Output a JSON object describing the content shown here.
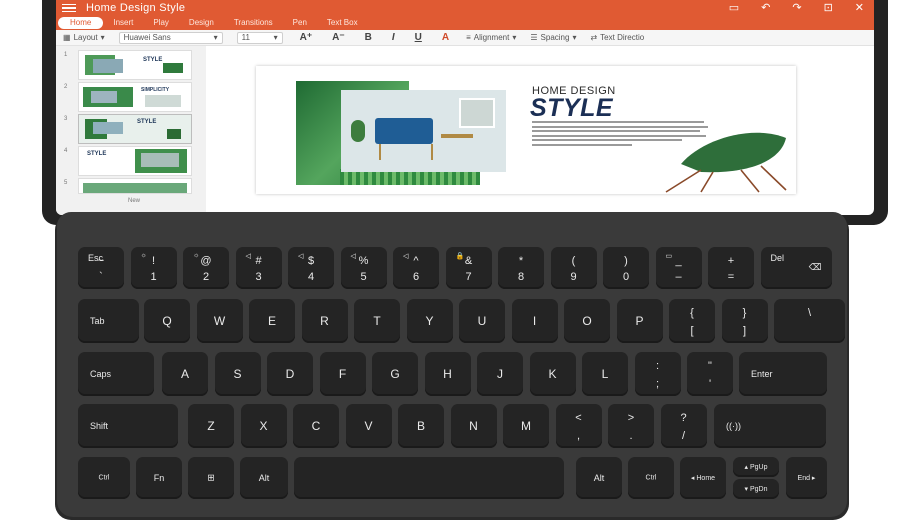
{
  "app": {
    "title": "Home Design Style",
    "title_icons": [
      "slideshow-icon",
      "undo-icon",
      "redo-icon",
      "share-icon",
      "close-icon"
    ],
    "accent": "#e05a33"
  },
  "tabs": [
    "Home",
    "Insert",
    "Play",
    "Design",
    "Transitions",
    "Pen",
    "Text Box"
  ],
  "toolbar": {
    "layout": "Layout",
    "font": "Huawei Sans",
    "size": "11",
    "alignment": "Alignment",
    "spacing": "Spacing",
    "text_direction": "Text Directio"
  },
  "thumbnails": {
    "numbers": [
      "1",
      "2",
      "3",
      "4",
      "5"
    ],
    "titles": [
      "STYLE",
      "SIMPLICITY",
      "STYLE",
      "STYLE",
      ""
    ],
    "new_label": "New"
  },
  "slide": {
    "small_title": "HOME DESIGN",
    "big_title": "STYLE"
  },
  "keyboard": {
    "row1": [
      {
        "up": "~",
        "dn": "`",
        "tl": "Esc"
      },
      {
        "up": "!",
        "dn": "1",
        "fn": "☼"
      },
      {
        "up": "@",
        "dn": "2",
        "fn": "☼"
      },
      {
        "up": "#",
        "dn": "3",
        "fn": "◁"
      },
      {
        "up": "$",
        "dn": "4",
        "fn": "◁"
      },
      {
        "up": "%",
        "dn": "5",
        "fn": "◁"
      },
      {
        "up": "^",
        "dn": "6",
        "fn": "◁"
      },
      {
        "up": "&",
        "dn": "7",
        "fn": "🔒"
      },
      {
        "up": "*",
        "dn": "8"
      },
      {
        "up": "(",
        "dn": "9"
      },
      {
        "up": ")",
        "dn": "0"
      },
      {
        "up": "_",
        "dn": "–",
        "fn": "▭"
      },
      {
        "up": "+",
        "dn": "="
      },
      {
        "tl": "Del",
        "tr": "⌫"
      }
    ],
    "row2": [
      "Tab",
      "Q",
      "W",
      "E",
      "R",
      "T",
      "Y",
      "U",
      "I",
      "O",
      "P",
      "{|[",
      "}|]",
      "\\||"
    ],
    "row3": [
      "Caps",
      "A",
      "S",
      "D",
      "F",
      "G",
      "H",
      "J",
      "K",
      "L",
      ":|;",
      "\"|'",
      "Enter"
    ],
    "row4": [
      "Shift",
      "Z",
      "X",
      "C",
      "V",
      "B",
      "N",
      "M",
      "<|,",
      ">|.",
      "?|/",
      "((·))"
    ],
    "row5": [
      "Ctrl",
      "Fn",
      "⊞",
      "Alt",
      "",
      "Alt",
      "Ctrl",
      "◂ Home",
      "▴ PgUp",
      "▾ PgDn",
      "End ▸"
    ]
  }
}
